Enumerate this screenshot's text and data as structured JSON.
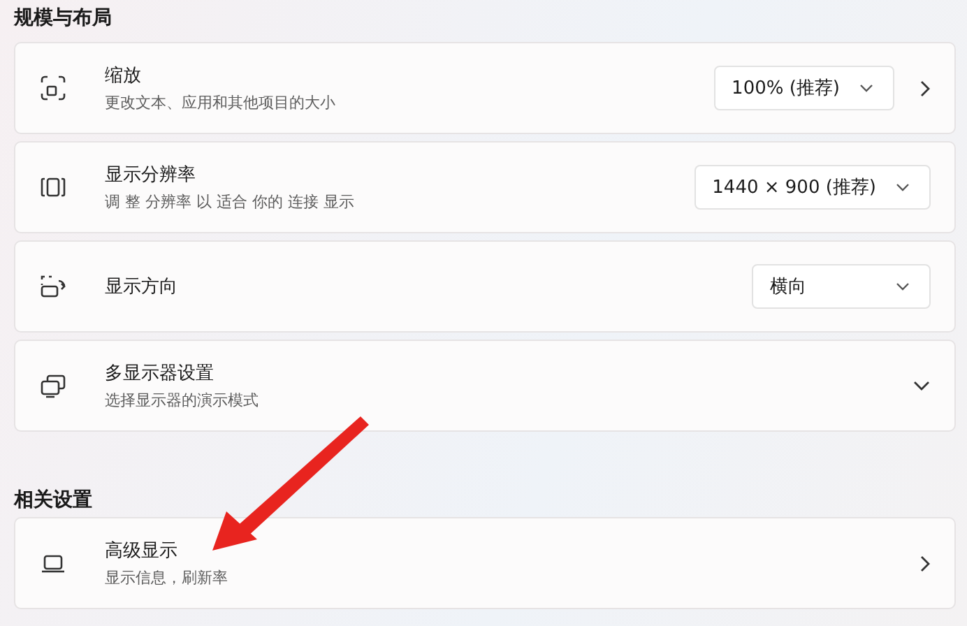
{
  "sections": [
    {
      "title": "规模与布局",
      "items": [
        {
          "title": "缩放",
          "subtitle": "更改文本、应用和其他项目的大小",
          "dropdown": "100% (推荐)",
          "kind": "link"
        },
        {
          "title": "显示分辨率",
          "subtitle": "调 整 分辨率 以 适合 你的 连接 显示",
          "dropdown": "1440 × 900 (推荐)",
          "kind": "plain"
        },
        {
          "title": "显示方向",
          "dropdown": "横向",
          "kind": "plain"
        },
        {
          "title": "多显示器设置",
          "subtitle": "选择显示器的演示模式",
          "kind": "expand"
        }
      ]
    },
    {
      "title": "相关设置",
      "items": [
        {
          "title": "高级显示",
          "subtitle": "显示信息，刷新率",
          "kind": "link"
        }
      ]
    }
  ],
  "annotation": {
    "kind": "arrow"
  }
}
